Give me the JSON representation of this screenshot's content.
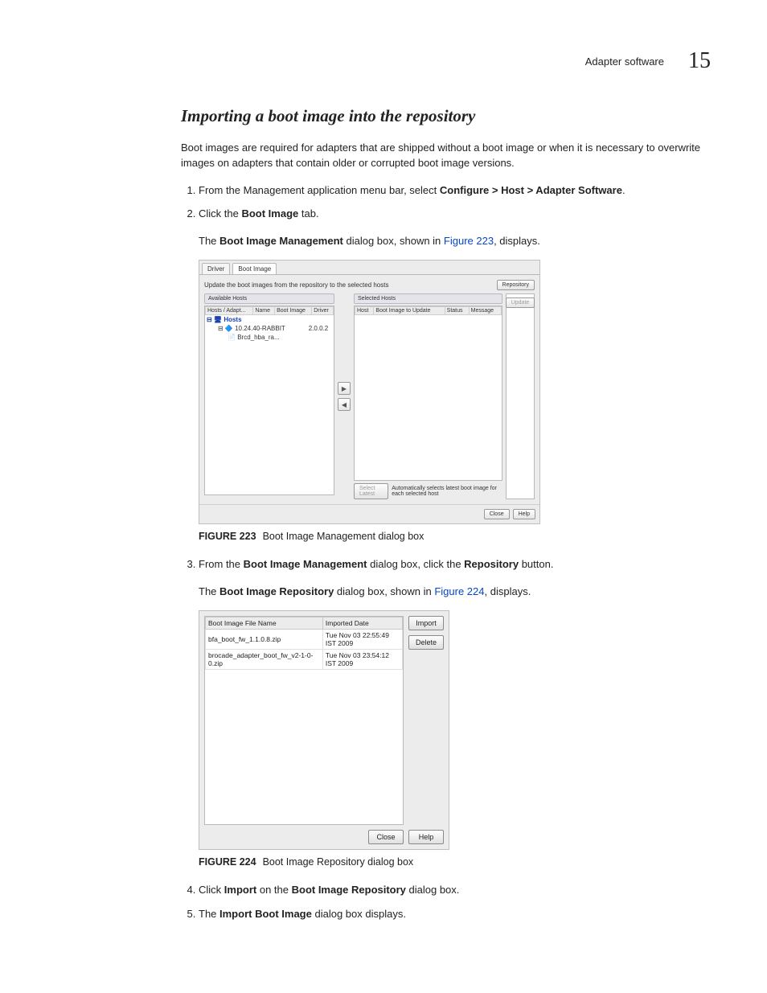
{
  "header": {
    "running": "Adapter software",
    "page": "15"
  },
  "heading": "Importing a boot image into the repository",
  "intro": "Boot images are required for adapters that are shipped without a boot image or when it is necessary to overwrite images on adapters that contain older or corrupted boot image versions.",
  "step1": {
    "pre": "From the Management application menu bar, select ",
    "path": "Configure > Host > Adapter Software",
    "post": "."
  },
  "step2": {
    "pre": "Click the ",
    "bold": "Boot Image",
    "post": " tab."
  },
  "step2b": {
    "pre": "The ",
    "bold": "Boot Image Management",
    "mid": " dialog box, shown in ",
    "link": "Figure 223",
    "post": ", displays."
  },
  "fig1_caption": {
    "label": "FIGURE 223",
    "text": "Boot Image Management dialog box"
  },
  "step3": {
    "pre": "From the ",
    "bold": "Boot Image Management",
    "mid": " dialog box, click the ",
    "bold2": "Repository",
    "post": " button."
  },
  "step3b": {
    "pre": "The ",
    "bold": "Boot Image Repository",
    "mid": " dialog box, shown in ",
    "link": "Figure 224",
    "post": ", displays."
  },
  "fig2_caption": {
    "label": "FIGURE 224",
    "text": "Boot Image Repository dialog box"
  },
  "step4": {
    "pre": "Click ",
    "bold": "Import",
    "mid": " on the ",
    "bold2": "Boot Image Repository",
    "post": " dialog box."
  },
  "step5": {
    "pre": "The ",
    "bold": "Import Boot Image",
    "post": " dialog box displays."
  },
  "dlg1": {
    "tabs": {
      "driver": "Driver",
      "bootimage": "Boot Image"
    },
    "desc": "Update the boot images from the repository to the selected hosts",
    "repo_btn": "Repository",
    "left_title": "Available Hosts",
    "left_cols": {
      "c1": "Hosts / Adapt...",
      "c2": "Name",
      "c3": "Boot Image",
      "c4": "Driver"
    },
    "left_rows": {
      "root": "Hosts",
      "r1_name": "10.24.40-RABBIT",
      "r1_driver": "2.0.0.2",
      "r2_name": "Brcd_hba_ra..."
    },
    "right_title": "Selected Hosts",
    "right_cols": {
      "c1": "Host",
      "c2": "Boot Image to Update",
      "c3": "Status",
      "c4": "Message"
    },
    "update_btn": "Update",
    "auto_sel": "Select Latest",
    "auto_text": "Automatically selects latest boot image for each selected host",
    "close": "Close",
    "help": "Help"
  },
  "dlg2": {
    "cols": {
      "c1": "Boot Image File Name",
      "c2": "Imported Date"
    },
    "rows": [
      {
        "name": "bfa_boot_fw_1.1.0.8.zip",
        "date": "Tue Nov 03 22:55:49 IST 2009"
      },
      {
        "name": "brocade_adapter_boot_fw_v2-1-0-0.zip",
        "date": "Tue Nov 03 23:54:12 IST 2009"
      }
    ],
    "import": "Import",
    "delete": "Delete",
    "close": "Close",
    "help": "Help"
  }
}
